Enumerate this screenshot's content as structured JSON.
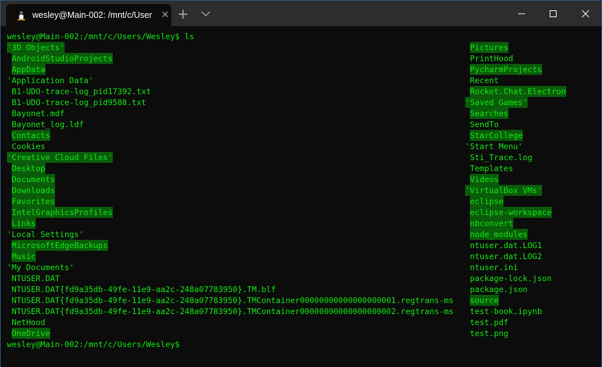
{
  "window": {
    "tab_title": "wesley@Main-002: /mnt/c/User",
    "tab_icon": "linux-tux-icon",
    "new_tab_label": "+",
    "controls": [
      "minimize",
      "maximize",
      "close"
    ]
  },
  "colors": {
    "terminal_bg": "#0c0c0c",
    "text_green": "#13e813",
    "dir_highlight_bg": "#0a5c0a",
    "titlebar_bg": "#2d2d2d",
    "window_border": "#2b5a8a"
  },
  "terminal": {
    "command_prompt": "wesley@Main-002:/mnt/c/Users/Wesley$ ls",
    "final_prompt": "wesley@Main-002:/mnt/c/Users/Wesley$",
    "left_column": [
      {
        "name": "'3D Objects'",
        "quoted": true,
        "highlight": true
      },
      {
        "name": "AndroidStudioProjects",
        "quoted": false,
        "highlight": true
      },
      {
        "name": "AppData",
        "quoted": false,
        "highlight": true
      },
      {
        "name": "'Application Data'",
        "quoted": true,
        "highlight": false
      },
      {
        "name": "B1-UDO-trace-log_pid17392.txt",
        "quoted": false,
        "highlight": false
      },
      {
        "name": "B1-UDO-trace-log_pid9588.txt",
        "quoted": false,
        "highlight": false
      },
      {
        "name": "Bayonet.mdf",
        "quoted": false,
        "highlight": false
      },
      {
        "name": "Bayonet_log.ldf",
        "quoted": false,
        "highlight": false
      },
      {
        "name": "Contacts",
        "quoted": false,
        "highlight": true
      },
      {
        "name": "Cookies",
        "quoted": false,
        "highlight": false
      },
      {
        "name": "'Creative Cloud Files'",
        "quoted": true,
        "highlight": true
      },
      {
        "name": "Desktop",
        "quoted": false,
        "highlight": true
      },
      {
        "name": "Documents",
        "quoted": false,
        "highlight": true
      },
      {
        "name": "Downloads",
        "quoted": false,
        "highlight": true
      },
      {
        "name": "Favorites",
        "quoted": false,
        "highlight": true
      },
      {
        "name": "IntelGraphicsProfiles",
        "quoted": false,
        "highlight": true
      },
      {
        "name": "Links",
        "quoted": false,
        "highlight": true
      },
      {
        "name": "'Local Settings'",
        "quoted": true,
        "highlight": false
      },
      {
        "name": "MicrosoftEdgeBackups",
        "quoted": false,
        "highlight": true
      },
      {
        "name": "Music",
        "quoted": false,
        "highlight": true
      },
      {
        "name": "'My Documents'",
        "quoted": true,
        "highlight": false
      },
      {
        "name": "NTUSER.DAT",
        "quoted": false,
        "highlight": false
      },
      {
        "name": "NTUSER.DAT{fd9a35db-49fe-11e9-aa2c-248a07783950}.TM.blf",
        "quoted": false,
        "highlight": false
      },
      {
        "name": "NTUSER.DAT{fd9a35db-49fe-11e9-aa2c-248a07783950}.TMContainer00000000000000000001.regtrans-ms",
        "quoted": false,
        "highlight": false
      },
      {
        "name": "NTUSER.DAT{fd9a35db-49fe-11e9-aa2c-248a07783950}.TMContainer00000000000000000002.regtrans-ms",
        "quoted": false,
        "highlight": false
      },
      {
        "name": "NetHood",
        "quoted": false,
        "highlight": false
      },
      {
        "name": "OneDrive",
        "quoted": false,
        "highlight": true
      }
    ],
    "right_column": [
      {
        "name": "Pictures",
        "quoted": false,
        "highlight": true
      },
      {
        "name": "PrintHood",
        "quoted": false,
        "highlight": false
      },
      {
        "name": "PycharmProjects",
        "quoted": false,
        "highlight": true
      },
      {
        "name": "Recent",
        "quoted": false,
        "highlight": false
      },
      {
        "name": "Rocket.Chat.Electron",
        "quoted": false,
        "highlight": true
      },
      {
        "name": "'Saved Games'",
        "quoted": true,
        "highlight": true
      },
      {
        "name": "Searches",
        "quoted": false,
        "highlight": true
      },
      {
        "name": "SendTo",
        "quoted": false,
        "highlight": false
      },
      {
        "name": "StarCollege",
        "quoted": false,
        "highlight": true
      },
      {
        "name": "'Start Menu'",
        "quoted": true,
        "highlight": false
      },
      {
        "name": "Sti_Trace.log",
        "quoted": false,
        "highlight": false
      },
      {
        "name": "Templates",
        "quoted": false,
        "highlight": false
      },
      {
        "name": "Videos",
        "quoted": false,
        "highlight": true
      },
      {
        "name": "'VirtualBox VMs'",
        "quoted": true,
        "highlight": true
      },
      {
        "name": "eclipse",
        "quoted": false,
        "highlight": true
      },
      {
        "name": "eclipse-workspace",
        "quoted": false,
        "highlight": true
      },
      {
        "name": "nbconvert",
        "quoted": false,
        "highlight": true
      },
      {
        "name": "node_modules",
        "quoted": false,
        "highlight": true
      },
      {
        "name": "ntuser.dat.LOG1",
        "quoted": false,
        "highlight": false
      },
      {
        "name": "ntuser.dat.LOG2",
        "quoted": false,
        "highlight": false
      },
      {
        "name": "ntuser.ini",
        "quoted": false,
        "highlight": false
      },
      {
        "name": "package-lock.json",
        "quoted": false,
        "highlight": false
      },
      {
        "name": "package.json",
        "quoted": false,
        "highlight": false
      },
      {
        "name": "source",
        "quoted": false,
        "highlight": true
      },
      {
        "name": "test-book.ipynb",
        "quoted": false,
        "highlight": false
      },
      {
        "name": "test.pdf",
        "quoted": false,
        "highlight": false
      },
      {
        "name": "test.png",
        "quoted": false,
        "highlight": false
      }
    ]
  }
}
